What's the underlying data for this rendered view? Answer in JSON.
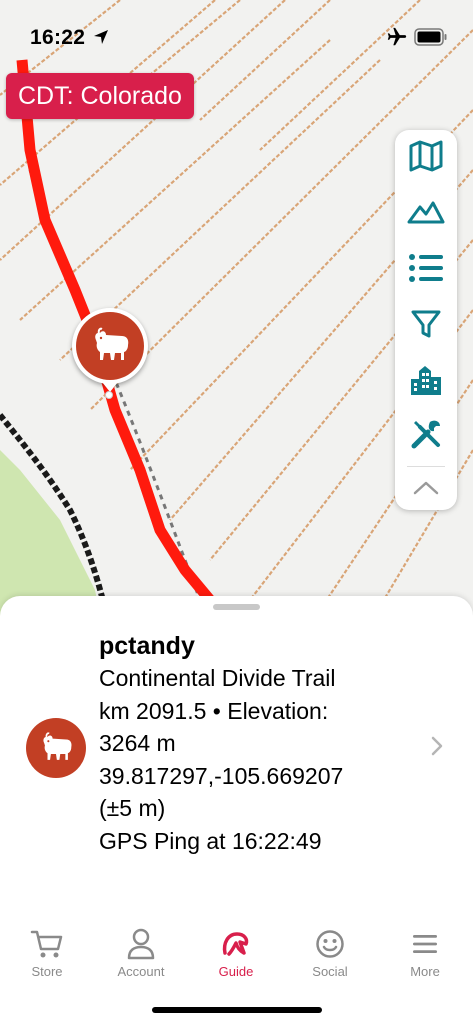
{
  "status_bar": {
    "time": "16:22",
    "location_icon": "location-arrow-icon",
    "airplane_icon": "airplane-icon",
    "battery_icon": "battery-icon"
  },
  "map": {
    "title": "CDT: Colorado",
    "trail_color": "#ff1a0d",
    "contour_color": "#d9a577",
    "marker_icon": "mountain-goat-icon",
    "marker_color": "#c23f24"
  },
  "toolbar": {
    "items": [
      {
        "name": "map-layers-icon"
      },
      {
        "name": "elevation-profile-icon"
      },
      {
        "name": "list-icon"
      },
      {
        "name": "filter-icon"
      },
      {
        "name": "town-icon"
      },
      {
        "name": "tools-icon"
      },
      {
        "name": "collapse-chevron-icon"
      }
    ],
    "accent": "#0f7d8c"
  },
  "sheet": {
    "username": "pctandy",
    "trail_name": "Continental Divide Trail",
    "km_elevation": "km 2091.5 • Elevation:",
    "elevation_value": "3264 m",
    "coordinates": "39.817297,-105.669207",
    "accuracy": "(±5 m)",
    "gps_ping": "GPS Ping at 16:22:49",
    "avatar_icon": "mountain-goat-icon"
  },
  "tabs": [
    {
      "label": "Store",
      "icon": "cart-icon",
      "active": false
    },
    {
      "label": "Account",
      "icon": "person-icon",
      "active": false
    },
    {
      "label": "Guide",
      "icon": "guide-logo-icon",
      "active": true
    },
    {
      "label": "Social",
      "icon": "smiley-icon",
      "active": false
    },
    {
      "label": "More",
      "icon": "menu-icon",
      "active": false
    }
  ],
  "colors": {
    "brand": "#d81f4b",
    "inactive": "#8a8a8a"
  }
}
